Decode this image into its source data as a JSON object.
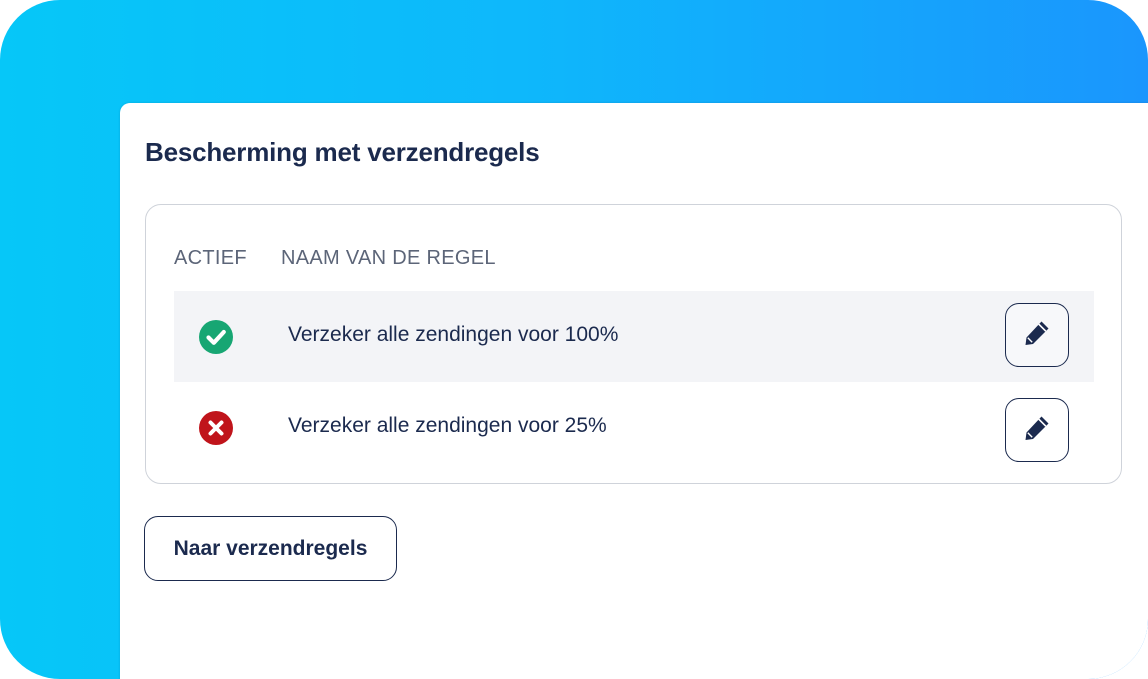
{
  "section": {
    "title": "Bescherming met verzendregels"
  },
  "table": {
    "headers": {
      "active": "ACTIEF",
      "name": "NAAM VAN DE REGEL"
    },
    "rows": [
      {
        "active": true,
        "status_icon": "check-circle-icon",
        "name": "Verzeker alle zendingen voor 100%",
        "edit_icon": "pencil-icon"
      },
      {
        "active": false,
        "status_icon": "x-circle-icon",
        "name": "Verzeker alle zendingen voor 25%",
        "edit_icon": "pencil-icon"
      }
    ]
  },
  "actions": {
    "to_rules_label": "Naar verzendregels"
  },
  "colors": {
    "accent_gradient_start": "#06c7f8",
    "accent_gradient_end": "#1a96fd",
    "text_primary": "#1b2a4e",
    "active_green": "#17a673",
    "inactive_red": "#c0141b"
  }
}
